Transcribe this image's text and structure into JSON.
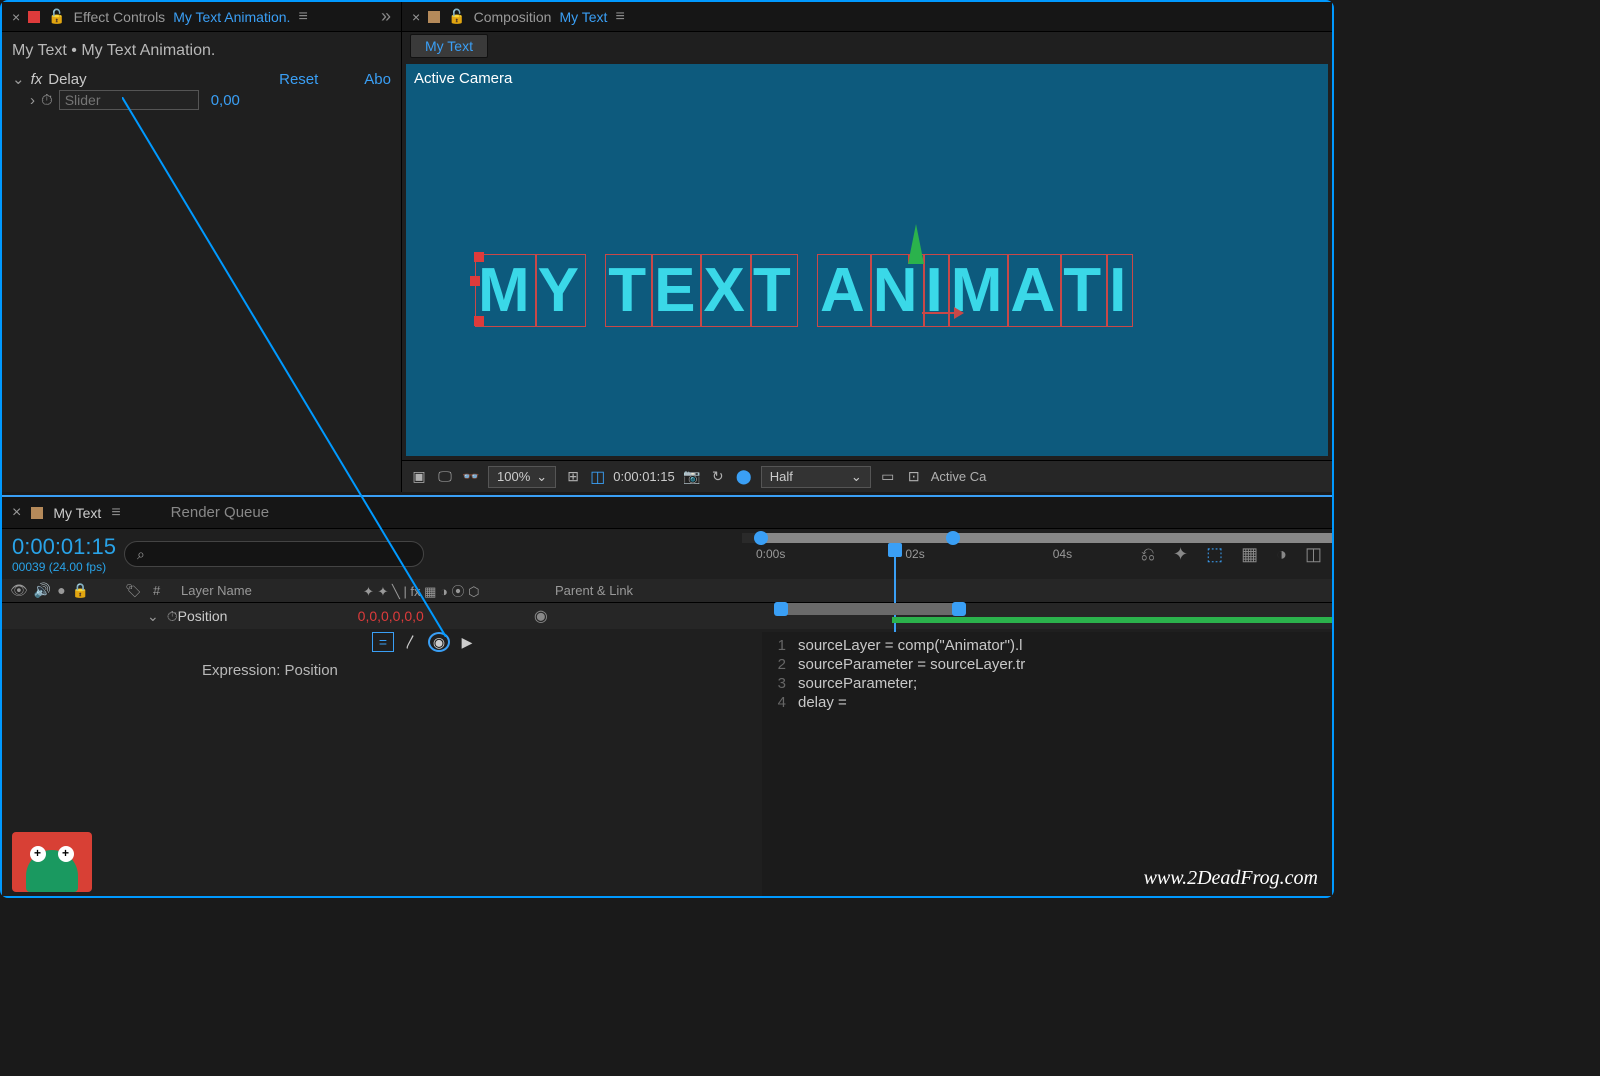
{
  "effect_panel": {
    "title": "Effect Controls",
    "comp_link": "My Text Animation.",
    "breadcrumb": "My Text • My Text Animation.",
    "effect_name": "Delay",
    "reset": "Reset",
    "about": "Abo",
    "slider_placeholder": "Slider",
    "slider_value": "0,00"
  },
  "comp_panel": {
    "title": "Composition",
    "comp_link": "My Text",
    "tab": "My Text",
    "camera": "Active Camera",
    "text": "MY TEXT ANIMATI"
  },
  "viewport_bar": {
    "zoom": "100%",
    "timecode": "0:00:01:15",
    "resolution": "Half",
    "view": "Active Ca"
  },
  "timeline": {
    "tab1": "My Text",
    "tab2": "Render Queue",
    "timecode": "0:00:01:15",
    "frame_info": "00039 (24.00 fps)",
    "ruler": {
      "t0": "0:00s",
      "t1": "02s",
      "t2": "04s"
    },
    "columns": {
      "num": "#",
      "name": "Layer Name",
      "parent": "Parent & Link"
    },
    "prop": {
      "name": "Position",
      "value": "0,0,0,0,0,0",
      "expr_label": "Expression: Position"
    },
    "code": {
      "l1": "sourceLayer = comp(\"Animator\").l",
      "l2": "sourceParameter = sourceLayer.tr",
      "l3": "sourceParameter;",
      "l4": "delay ="
    }
  },
  "watermark": "www.2DeadFrog.com"
}
